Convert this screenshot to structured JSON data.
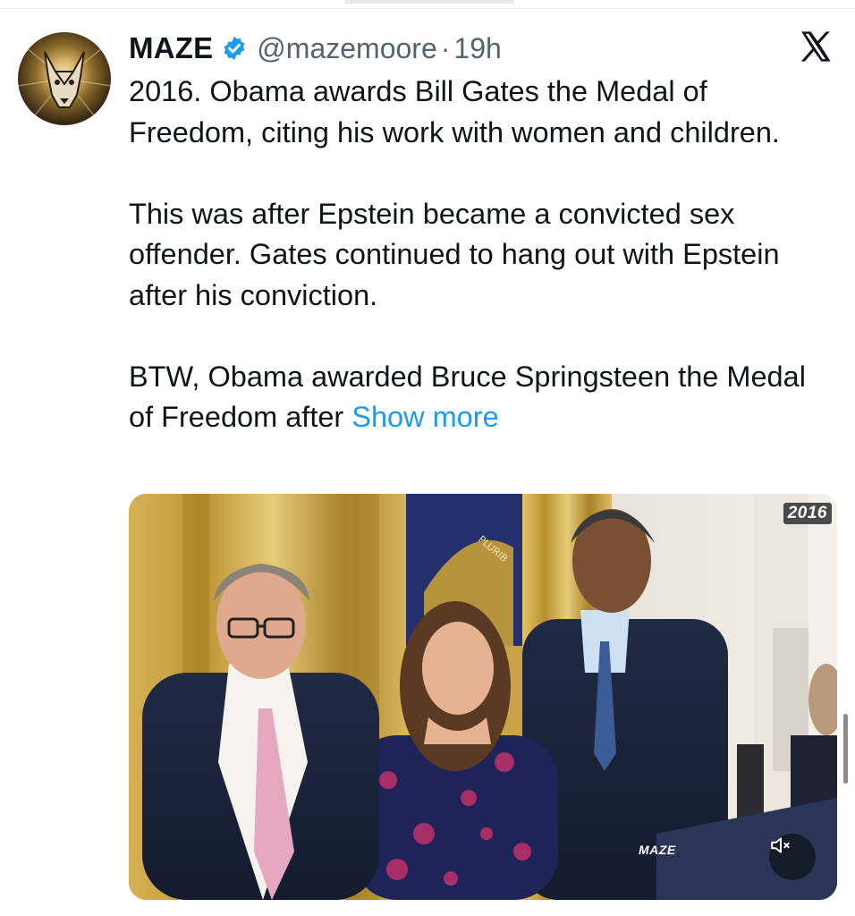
{
  "tweet": {
    "display_name": "MAZE",
    "handle": "@mazemoore",
    "separator": "·",
    "time": "19h",
    "paragraphs": [
      "2016. Obama awards Bill Gates the Medal of Freedom, citing his work with women and children.",
      "This was after Epstein became a convicted sex offender. Gates continued to hang out with Epstein after his conviction.",
      "BTW, Obama awarded Bruce Springsteen the Medal of Freedom after "
    ],
    "show_more": "Show more"
  },
  "media": {
    "year_badge": "2016",
    "watermark": "MAZE",
    "seal_text": "PLURIB"
  },
  "icons": {
    "verified": "verified-badge-icon",
    "platform": "x-logo-icon",
    "mute": "speaker-muted-icon"
  },
  "colors": {
    "accent": "#1d9bf0",
    "muted_text": "#536471",
    "text": "#0f1419"
  }
}
